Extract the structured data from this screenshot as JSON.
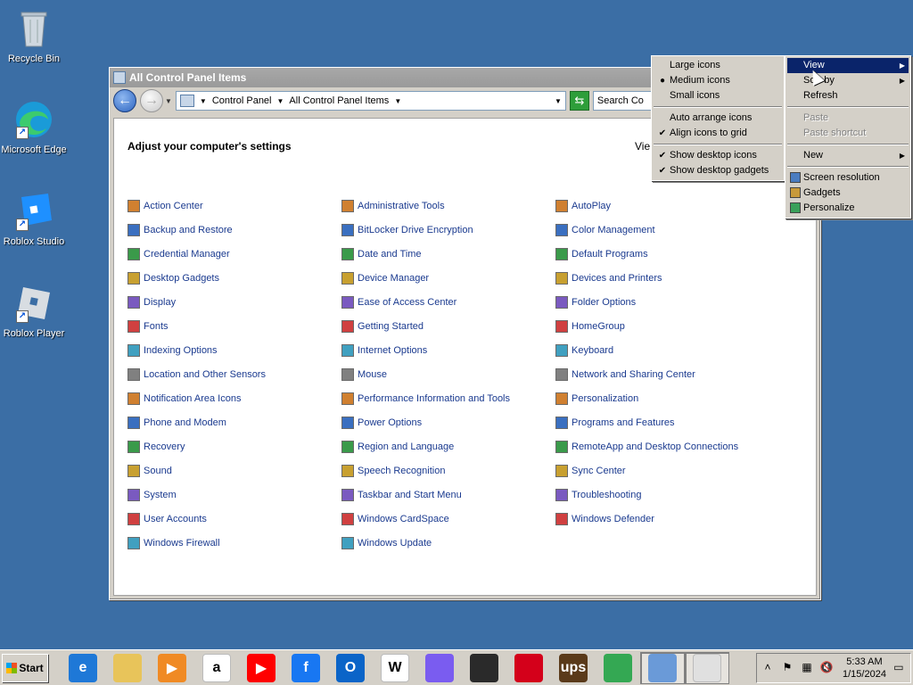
{
  "desktop": {
    "icons": [
      {
        "label": "Recycle Bin"
      },
      {
        "label": "Microsoft Edge"
      },
      {
        "label": "Roblox Studio"
      },
      {
        "label": "Roblox Player"
      }
    ]
  },
  "window": {
    "title": "All Control Panel Items",
    "address": {
      "crumb1": "Control Panel",
      "crumb2": "All Control Panel Items"
    },
    "search_placeholder": "Search Co",
    "heading": "Adjust your computer's settings",
    "view_by": "Vie",
    "items": {
      "col1": [
        "Action Center",
        "Backup and Restore",
        "Credential Manager",
        "Desktop Gadgets",
        "Display",
        "Fonts",
        "Indexing Options",
        "Location and Other Sensors",
        "Notification Area Icons",
        "Phone and Modem",
        "Recovery",
        "Sound",
        "System",
        "User Accounts",
        "Windows Firewall"
      ],
      "col2": [
        "Administrative Tools",
        "BitLocker Drive Encryption",
        "Date and Time",
        "Device Manager",
        "Ease of Access Center",
        "Getting Started",
        "Internet Options",
        "Mouse",
        "Performance Information and Tools",
        "Power Options",
        "Region and Language",
        "Speech Recognition",
        "Taskbar and Start Menu",
        "Windows CardSpace",
        "Windows Update"
      ],
      "col3": [
        "AutoPlay",
        "Color Management",
        "Default Programs",
        "Devices and Printers",
        "Folder Options",
        "HomeGroup",
        "Keyboard",
        "Network and Sharing Center",
        "Personalization",
        "Programs and Features",
        "RemoteApp and Desktop Connections",
        "Sync Center",
        "Troubleshooting",
        "Windows Defender"
      ]
    }
  },
  "context_menu": {
    "view": "View",
    "sort_by": "Sort by",
    "refresh": "Refresh",
    "paste": "Paste",
    "paste_shortcut": "Paste shortcut",
    "new": "New",
    "screen_resolution": "Screen resolution",
    "gadgets": "Gadgets",
    "personalize": "Personalize"
  },
  "view_submenu": {
    "large_icons": "Large icons",
    "medium_icons": "Medium icons",
    "small_icons": "Small icons",
    "auto_arrange": "Auto arrange icons",
    "align_grid": "Align icons to grid",
    "show_desktop_icons": "Show desktop icons",
    "show_gadgets": "Show desktop gadgets"
  },
  "taskbar": {
    "start_label": "Start",
    "time": "5:33 AM",
    "date": "1/15/2024",
    "apps": [
      {
        "name": "internet-explorer-icon",
        "glyph": "e",
        "color": "#1e78d7"
      },
      {
        "name": "file-explorer-icon",
        "glyph": "",
        "color": "#e8c45a"
      },
      {
        "name": "media-player-icon",
        "glyph": "▶",
        "color": "#f08a24"
      },
      {
        "name": "amazon-icon",
        "glyph": "a",
        "color": "#ffffff"
      },
      {
        "name": "youtube-icon",
        "glyph": "▶",
        "color": "#ff0000"
      },
      {
        "name": "facebook-icon",
        "glyph": "f",
        "color": "#1877f2"
      },
      {
        "name": "outlook-icon",
        "glyph": "O",
        "color": "#0a64c8"
      },
      {
        "name": "wikipedia-icon",
        "glyph": "W",
        "color": "#ffffff"
      },
      {
        "name": "copilot-icon",
        "glyph": "",
        "color": "#7a5cf0"
      },
      {
        "name": "store-icon",
        "glyph": "",
        "color": "#2a2a2a"
      },
      {
        "name": "bank-of-america-icon",
        "glyph": "",
        "color": "#d4001a"
      },
      {
        "name": "ups-icon",
        "glyph": "ups",
        "color": "#5a3a1a"
      },
      {
        "name": "chrome-icon",
        "glyph": "",
        "color": "#34a853"
      },
      {
        "name": "control-panel-icon",
        "glyph": "",
        "color": "#6a9ad8"
      },
      {
        "name": "mouse-icon",
        "glyph": "",
        "color": "#e0e0e0"
      }
    ]
  }
}
